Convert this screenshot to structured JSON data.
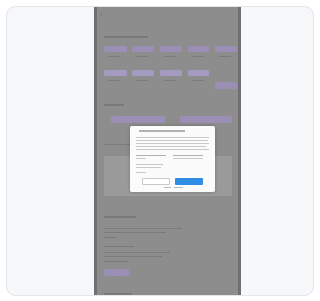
{
  "window": {
    "title": ""
  },
  "cookie_modal": {
    "title": "",
    "decline_label": "",
    "accept_label": ""
  },
  "colors": {
    "page_background": "#ffffff",
    "card_background": "#f7f8fa",
    "screen_overlay": "#8d8d8d",
    "pill_accent": "#9b8fb5",
    "accept_button": "#2f8de4"
  },
  "icons": {
    "back": "chevron-left-icon"
  }
}
